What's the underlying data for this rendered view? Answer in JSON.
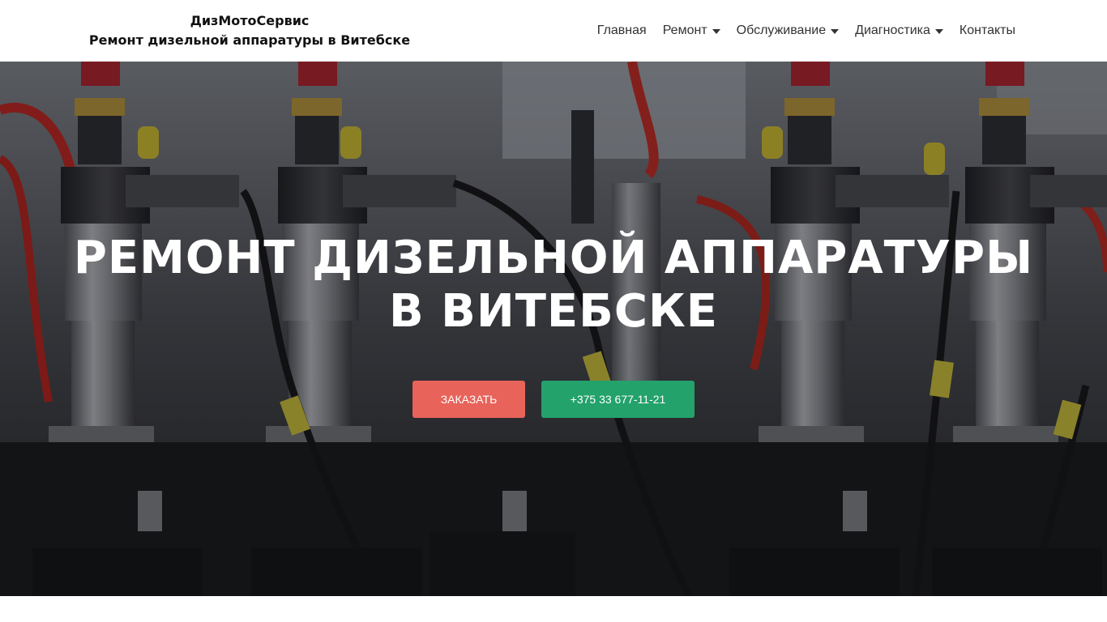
{
  "brand": {
    "name": "ДизМотоСервис",
    "tagline": "Ремонт дизельной аппаратуры в Витебске"
  },
  "nav": {
    "items": [
      {
        "label": "Главная",
        "has_dropdown": false
      },
      {
        "label": "Ремонт",
        "has_dropdown": true
      },
      {
        "label": "Обслуживание",
        "has_dropdown": true
      },
      {
        "label": "Диагностика",
        "has_dropdown": true
      },
      {
        "label": "Контакты",
        "has_dropdown": false
      }
    ]
  },
  "hero": {
    "title_line1": "РЕМОНТ ДИЗЕЛЬНОЙ АППАРАТУРЫ",
    "title_line2": "В ВИТЕБСКЕ",
    "background_image": "diesel-injectors-on-test-bench-photo",
    "order_button": "ЗАКАЗАТЬ",
    "phone_button": "+375 33 677-11-21"
  },
  "colors": {
    "order_button": "#e8635a",
    "phone_button": "#23a26b",
    "caret": "#333333"
  }
}
